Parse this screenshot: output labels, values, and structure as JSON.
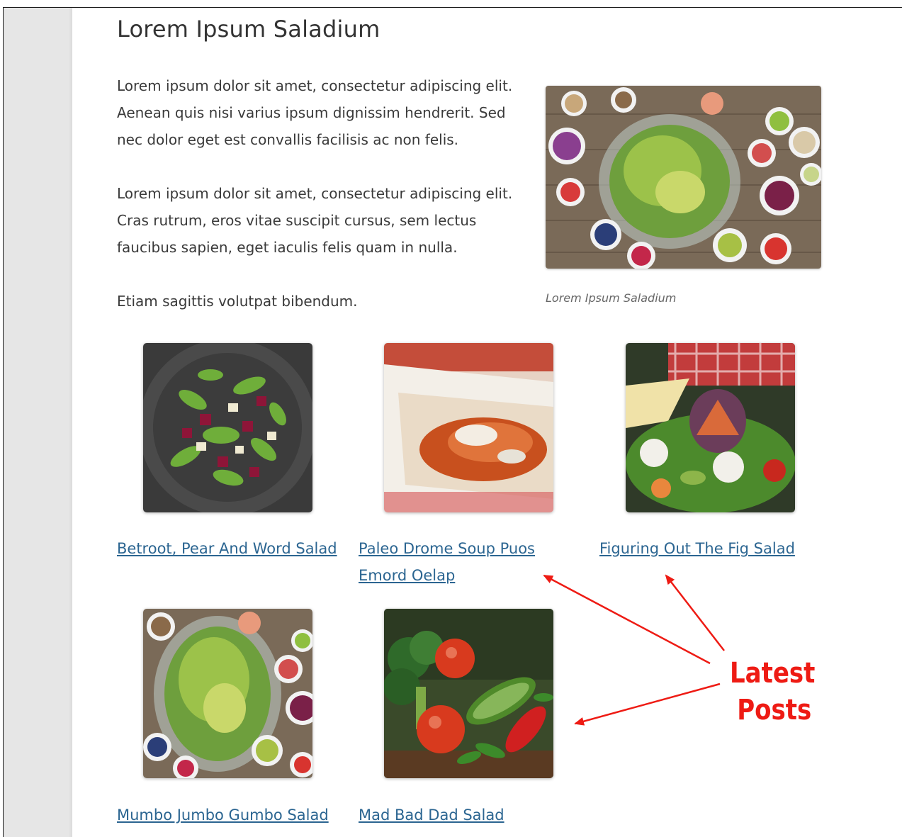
{
  "page": {
    "title": "Lorem Ipsum Saladium",
    "paragraphs": [
      "Lorem ipsum dolor sit amet, consectetur adipiscing elit. Aenean quis nisi varius ipsum dignissim hendrerit. Sed nec dolor eget est convallis facilisis ac non felis.",
      "Lorem ipsum dolor sit amet, consectetur adipiscing elit. Cras rutrum, eros vitae suscipit cursus, sem lectus faucibus sapien, eget iaculis felis quam in nulla.",
      "Etiam sagittis volutpat bibendum."
    ],
    "figure_caption": "Lorem Ipsum Saladium"
  },
  "latest_posts": [
    {
      "title": "Betroot, Pear And Word Salad",
      "image": "beetroot-salad-photo"
    },
    {
      "title": "Paleo Drome Soup Puos Emord Oelap",
      "image": "cookbook-photo"
    },
    {
      "title": "Figuring Out The Fig Salad",
      "image": "fig-salad-photo"
    },
    {
      "title": "Mumbo Jumbo Gumbo Salad",
      "image": "salad-bowls-photo"
    },
    {
      "title": "Mad Bad Dad Salad",
      "image": "vegetables-photo"
    }
  ],
  "annotation": {
    "line1": "Latest",
    "line2": "Posts",
    "color": "#ee1b14"
  },
  "colors": {
    "link": "#2b6591",
    "rail": "#e6e6e6"
  }
}
